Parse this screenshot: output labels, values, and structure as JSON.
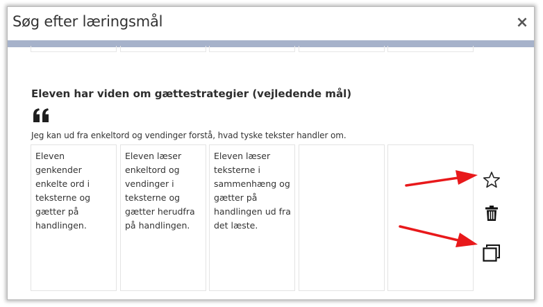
{
  "dialog": {
    "title": "Søg efter læringsmål",
    "close_label": "×"
  },
  "goal": {
    "heading": "Eleven har viden om gættestrategier (vejledende mål)",
    "text": "Jeg kan ud fra enkeltord og vendinger forstå, hvad tyske tekster handler om.",
    "levels": [
      "Eleven genkender enkelte ord i teksterne og gætter på handlingen.",
      "Eleven læser enkeltord og vendinger i teksterne og gætter herudfra på handlingen.",
      "Eleven læser teksterne i sammenhæng og gætter på handlingen ud fra det læste.",
      "",
      ""
    ]
  },
  "actions": [
    "star-icon",
    "trash-icon",
    "copy-icon"
  ],
  "colors": {
    "title_stripe": "#a6b2ca",
    "arrow": "#e8191b",
    "cell_border": "#e3e3e3"
  }
}
